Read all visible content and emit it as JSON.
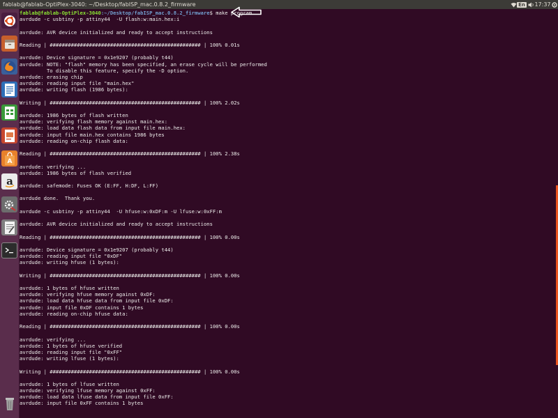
{
  "window": {
    "title": "fablab@fablab-OptiPlex-3040: ~/Desktop/fabISP_mac.0.8.2_firmware"
  },
  "panel": {
    "keyboard": "En",
    "time": "17:37"
  },
  "launcher": {
    "icons": [
      "ubuntu-logo-icon",
      "files-icon",
      "firefox-icon",
      "writer-icon",
      "calc-icon",
      "impress-icon",
      "software-center-icon",
      "amazon-icon",
      "settings-icon",
      "text-editor-icon",
      "terminal-icon",
      "trash-icon"
    ],
    "amazon_glyph": "a"
  },
  "terminal": {
    "prompt": {
      "user": "fablab@fablab-OptiPlex-3040",
      "path": ":~/Desktop/fabISP_mac.0.8.2_firmware",
      "symbol": "$",
      "command": " make program"
    },
    "lines": [
      "avrdude -c usbtiny -p attiny44  -U flash:w:main.hex:i",
      "",
      "avrdude: AVR device initialized and ready to accept instructions",
      "",
      "Reading | ################################################## | 100% 0.01s",
      "",
      "avrdude: Device signature = 0x1e9207 (probably t44)",
      "avrdude: NOTE: \"flash\" memory has been specified, an erase cycle will be performed",
      "         To disable this feature, specify the -D option.",
      "avrdude: erasing chip",
      "avrdude: reading input file \"main.hex\"",
      "avrdude: writing flash (1986 bytes):",
      "",
      "Writing | ################################################## | 100% 2.02s",
      "",
      "avrdude: 1986 bytes of flash written",
      "avrdude: verifying flash memory against main.hex:",
      "avrdude: load data flash data from input file main.hex:",
      "avrdude: input file main.hex contains 1986 bytes",
      "avrdude: reading on-chip flash data:",
      "",
      "Reading | ################################################## | 100% 2.38s",
      "",
      "avrdude: verifying ...",
      "avrdude: 1986 bytes of flash verified",
      "",
      "avrdude: safemode: Fuses OK (E:FF, H:DF, L:FF)",
      "",
      "avrdude done.  Thank you.",
      "",
      "avrdude -c usbtiny -p attiny44  -U hfuse:w:0xDF:m -U lfuse:w:0xFF:m",
      "",
      "avrdude: AVR device initialized and ready to accept instructions",
      "",
      "Reading | ################################################## | 100% 0.00s",
      "",
      "avrdude: Device signature = 0x1e9207 (probably t44)",
      "avrdude: reading input file \"0xDF\"",
      "avrdude: writing hfuse (1 bytes):",
      "",
      "Writing | ################################################## | 100% 0.00s",
      "",
      "avrdude: 1 bytes of hfuse written",
      "avrdude: verifying hfuse memory against 0xDF:",
      "avrdude: load data hfuse data from input file 0xDF:",
      "avrdude: input file 0xDF contains 1 bytes",
      "avrdude: reading on-chip hfuse data:",
      "",
      "Reading | ################################################## | 100% 0.00s",
      "",
      "avrdude: verifying ...",
      "avrdude: 1 bytes of hfuse verified",
      "avrdude: reading input file \"0xFF\"",
      "avrdude: writing lfuse (1 bytes):",
      "",
      "Writing | ################################################## | 100% 0.00s",
      "",
      "avrdude: 1 bytes of lfuse written",
      "avrdude: verifying lfuse memory against 0xFF:",
      "avrdude: load data lfuse data from input file 0xFF:",
      "avrdude: input file 0xFF contains 1 bytes"
    ]
  },
  "colors": {
    "terminal_bg": "#300a24",
    "prompt_user": "#8ae234",
    "prompt_path": "#729fcf",
    "text": "#eeeeec",
    "launcher_bg": "#5a2d4c",
    "panel_bg": "#3c3b37"
  }
}
